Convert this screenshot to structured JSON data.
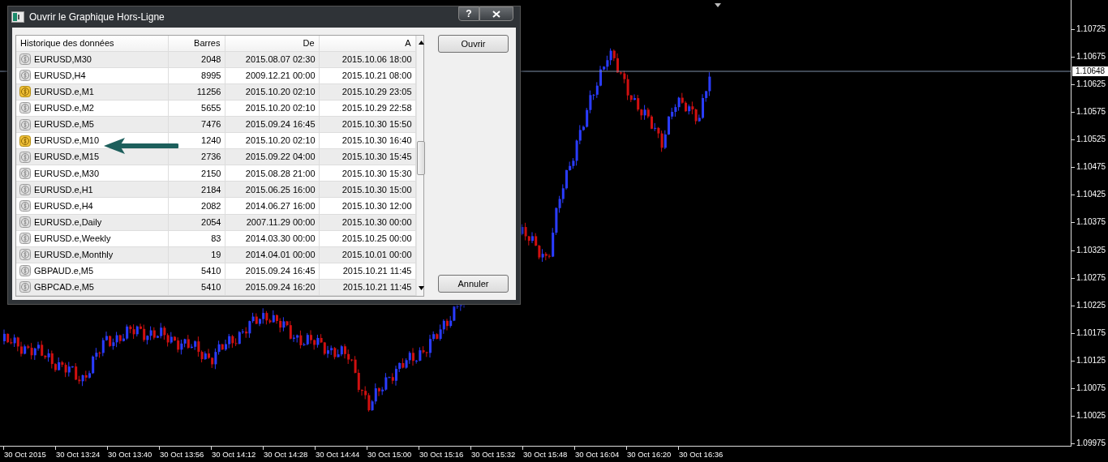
{
  "dialog": {
    "title": "Ouvrir le Graphique Hors-Ligne",
    "help_button": "?",
    "table": {
      "columns": [
        "Historique des données",
        "Barres",
        "De",
        "A"
      ],
      "rows": [
        {
          "symbol": "EURUSD,M30",
          "bars": "2048",
          "from": "2015.08.07 02:30",
          "to": "2015.10.06 18:00",
          "live": false
        },
        {
          "symbol": "EURUSD,H4",
          "bars": "8995",
          "from": "2009.12.21 00:00",
          "to": "2015.10.21 08:00",
          "live": false
        },
        {
          "symbol": "EURUSD.e,M1",
          "bars": "11256",
          "from": "2015.10.20 02:10",
          "to": "2015.10.29 23:05",
          "live": true
        },
        {
          "symbol": "EURUSD.e,M2",
          "bars": "5655",
          "from": "2015.10.20 02:10",
          "to": "2015.10.29 22:58",
          "live": false
        },
        {
          "symbol": "EURUSD.e,M5",
          "bars": "7476",
          "from": "2015.09.24 16:45",
          "to": "2015.10.30 15:50",
          "live": false
        },
        {
          "symbol": "EURUSD.e,M10",
          "bars": "1240",
          "from": "2015.10.20 02:10",
          "to": "2015.10.30 16:40",
          "live": true
        },
        {
          "symbol": "EURUSD.e,M15",
          "bars": "2736",
          "from": "2015.09.22 04:00",
          "to": "2015.10.30 15:45",
          "live": false
        },
        {
          "symbol": "EURUSD.e,M30",
          "bars": "2150",
          "from": "2015.08.28 21:00",
          "to": "2015.10.30 15:30",
          "live": false
        },
        {
          "symbol": "EURUSD.e,H1",
          "bars": "2184",
          "from": "2015.06.25 16:00",
          "to": "2015.10.30 15:00",
          "live": false
        },
        {
          "symbol": "EURUSD.e,H4",
          "bars": "2082",
          "from": "2014.06.27 16:00",
          "to": "2015.10.30 12:00",
          "live": false
        },
        {
          "symbol": "EURUSD.e,Daily",
          "bars": "2054",
          "from": "2007.11.29 00:00",
          "to": "2015.10.30 00:00",
          "live": false
        },
        {
          "symbol": "EURUSD.e,Weekly",
          "bars": "83",
          "from": "2014.03.30 00:00",
          "to": "2015.10.25 00:00",
          "live": false
        },
        {
          "symbol": "EURUSD.e,Monthly",
          "bars": "19",
          "from": "2014.04.01 00:00",
          "to": "2015.10.01 00:00",
          "live": false
        },
        {
          "symbol": "GBPAUD.e,M5",
          "bars": "5410",
          "from": "2015.09.24 16:45",
          "to": "2015.10.21 11:45",
          "live": false
        },
        {
          "symbol": "GBPCAD.e,M5",
          "bars": "5410",
          "from": "2015.09.24 16:20",
          "to": "2015.10.21 11:45",
          "live": false
        }
      ]
    },
    "buttons": [
      {
        "label": "Ouvrir"
      },
      {
        "label": "Annuler"
      }
    ]
  },
  "chart": {
    "current_price": "1.10648",
    "price_labels": [
      "1.10725",
      "1.10675",
      "1.10625",
      "1.10575",
      "1.10525",
      "1.10475",
      "1.10425",
      "1.10375",
      "1.10325",
      "1.10275",
      "1.10225",
      "1.10175",
      "1.10125",
      "1.10075",
      "1.10025",
      "1.09975"
    ],
    "time_labels": [
      "30 Oct 2015",
      "30 Oct 13:24",
      "30 Oct 13:40",
      "30 Oct 13:56",
      "30 Oct 14:12",
      "30 Oct 14:28",
      "30 Oct 14:44",
      "30 Oct 15:00",
      "30 Oct 15:16",
      "30 Oct 15:32",
      "30 Oct 15:48",
      "30 Oct 16:04",
      "30 Oct 16:20",
      "30 Oct 16:36"
    ]
  }
}
